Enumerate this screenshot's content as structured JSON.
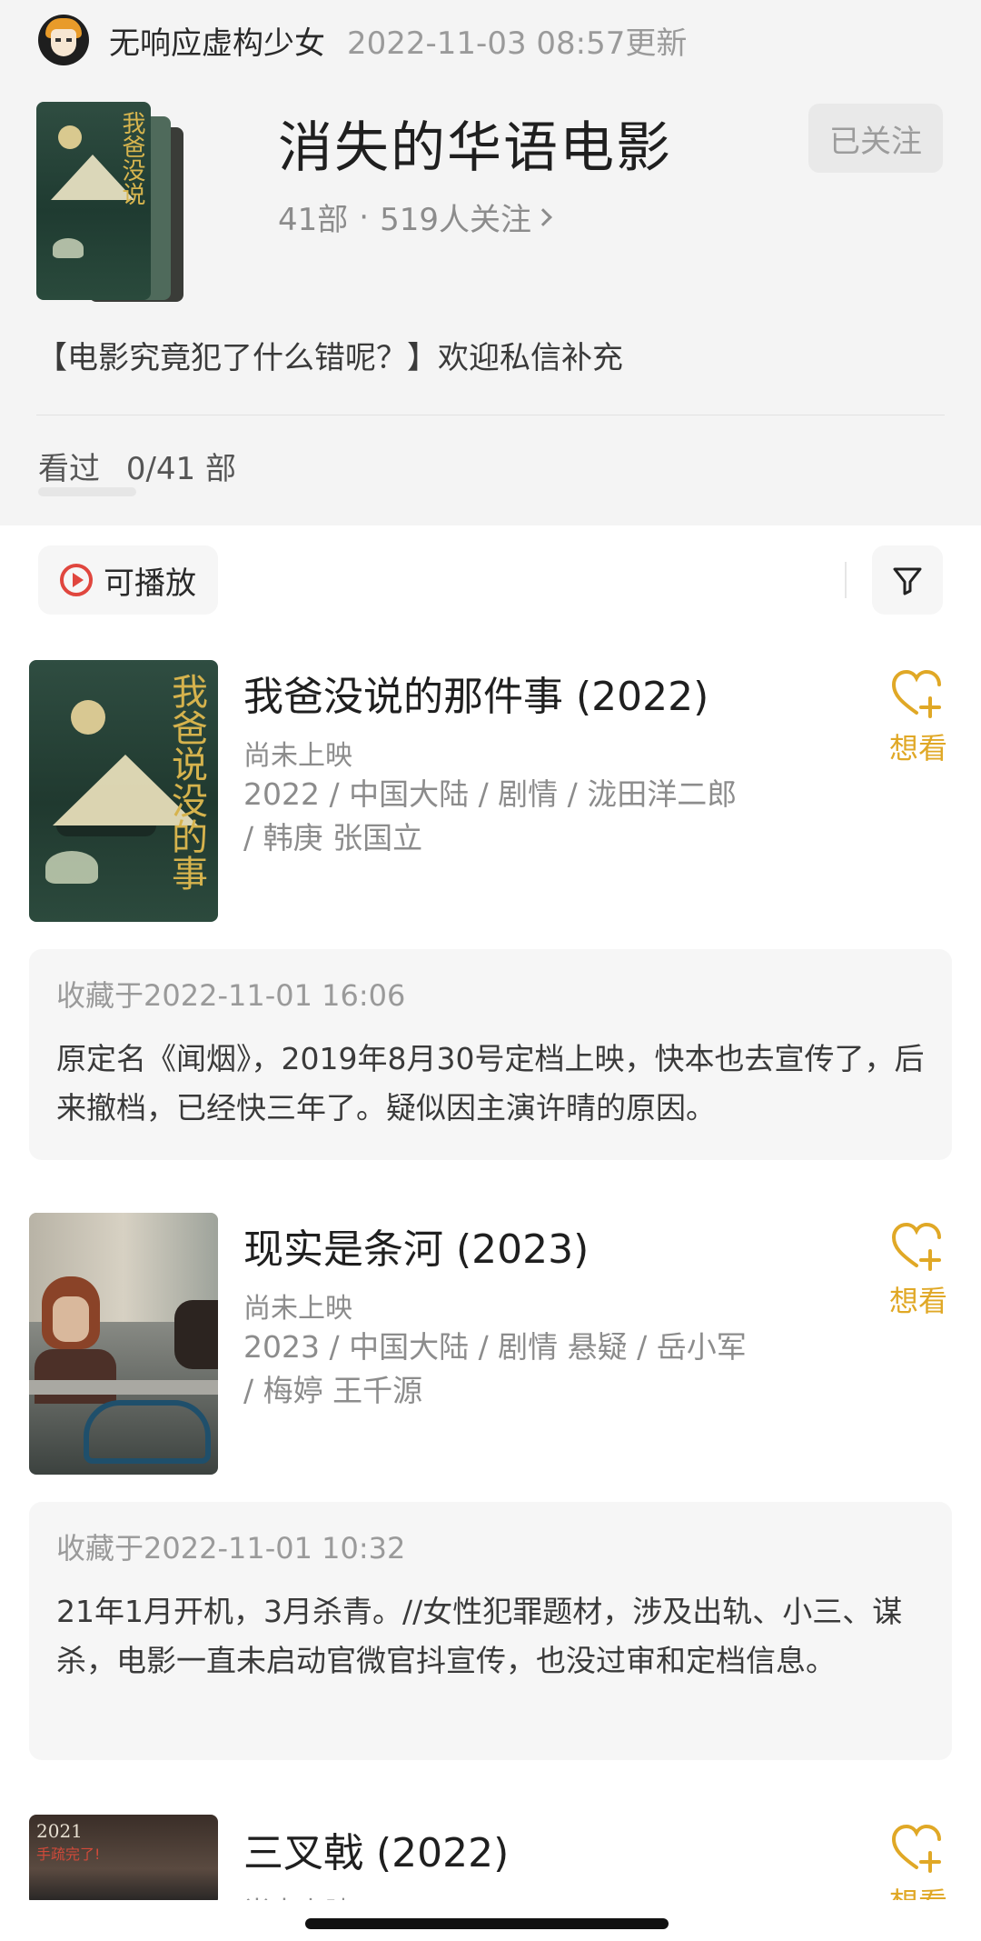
{
  "owner": {
    "name": "无响应虚构少女",
    "updated": "2022-11-03 08:57更新"
  },
  "list": {
    "title": "消失的华语电影",
    "count": "41部",
    "followers": "519人关注",
    "follow_label": "已关注",
    "description": "【电影究竟犯了什么错呢？】欢迎私信补充",
    "cover_glyph": "我爸没说"
  },
  "watched": {
    "label": "看过",
    "count": "0/41 部"
  },
  "filters": {
    "playable_label": "可播放"
  },
  "colors": {
    "accent_want": "#e0a826",
    "play_red": "#e0463e"
  },
  "movies": [
    {
      "title": "我爸没说的那件事 (2022)",
      "status": "尚未上映",
      "info": "2022 / 中国大陆 / 剧情 / 泷田洋二郎 / 韩庚 张国立",
      "want_label": "想看",
      "poster_glyph": "我爸说没的事",
      "note_date": "收藏于2022-11-01 16:06",
      "note_text": "原定名《闻烟》，2019年8月30号定档上映，快本也去宣传了，后来撤档，已经快三年了。疑似因主演许晴的原因。"
    },
    {
      "title": "现实是条河 (2023)",
      "status": "尚未上映",
      "info": "2023 / 中国大陆 / 剧情 悬疑 / 岳小军 / 梅婷 王千源",
      "want_label": "想看",
      "note_date": "收藏于2022-11-01 10:32",
      "note_text": "21年1月开机，3月杀青。//女性犯罪题材，涉及出轨、小三、谋杀，电影一直未启动官微官抖宣传，也没过审和定档信息。"
    },
    {
      "title": "三叉戟 (2022)",
      "status": "尚未上映",
      "want_label": "想看",
      "poster_year": "2021",
      "poster_sub": "手疏完了!"
    }
  ]
}
